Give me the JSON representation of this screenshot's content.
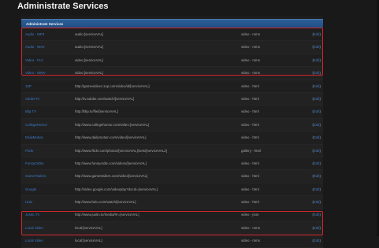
{
  "page": {
    "title": "Administrate Services"
  },
  "panel": {
    "header": "Administrate Services"
  },
  "rows": [
    {
      "name": "Audio - MP3",
      "url": "audio:[serviceVAL]",
      "type": "video - mms",
      "edit_prefix": "(",
      "edit_label": "Edit",
      "edit_suffix": ")"
    },
    {
      "name": "Audio - WAV",
      "url": "audio:[serviceVAL]",
      "type": "video - mms",
      "edit_prefix": "(",
      "edit_label": "Edit",
      "edit_suffix": ")"
    },
    {
      "name": "Video - FLV",
      "url": "video:[serviceVAL]",
      "type": "video - mms",
      "edit_prefix": "(",
      "edit_label": "Edit",
      "edit_suffix": ")"
    },
    {
      "name": "Video - WMV",
      "url": "video:[serviceVAL]",
      "type": "video - mms",
      "edit_prefix": "(",
      "edit_label": "Edit",
      "edit_suffix": ")"
    },
    {
      "name": "10P",
      "url": "http://gamevideos.1up.com/video/id/[serviceVAL]",
      "type": "video - html",
      "edit_prefix": "(",
      "edit_label": "Edit",
      "edit_suffix": ")"
    },
    {
      "name": "AdobeTV",
      "url": "http://tv.adobe.com/watch/[serviceVAL]",
      "type": "video - html",
      "edit_prefix": "(",
      "edit_label": "Edit",
      "edit_suffix": ")"
    },
    {
      "name": "Blip.TV",
      "url": "http://blip.tv/file/[serviceVAL]",
      "type": "video - html",
      "edit_prefix": "(",
      "edit_label": "Edit",
      "edit_suffix": ")"
    },
    {
      "name": "CollegeHumor",
      "url": "http://www.collegehumor.com/video:[serviceVAL]",
      "type": "video - html",
      "edit_prefix": "(",
      "edit_label": "Edit",
      "edit_suffix": ")"
    },
    {
      "name": "DailyMotion",
      "url": "http://www.dailymotion.com/video/[serviceVAL]",
      "type": "video - html",
      "edit_prefix": "(",
      "edit_label": "Edit",
      "edit_suffix": ")"
    },
    {
      "name": "Flickr",
      "url": "http://www.flickr.com/photos/[serviceVAL]/sets/[serviceVAL2]",
      "type": "gallery - html",
      "edit_prefix": "(",
      "edit_label": "Edit",
      "edit_suffix": ")"
    },
    {
      "name": "FunnyOrDie",
      "url": "http://www.funnyordie.com/videos/[serviceVAL]",
      "type": "video - html",
      "edit_prefix": "(",
      "edit_label": "Edit",
      "edit_suffix": ")"
    },
    {
      "name": "GameTrailers",
      "url": "http://www.gametrailers.com/video/[serviceVAL]",
      "type": "video - html",
      "edit_prefix": "(",
      "edit_label": "Edit",
      "edit_suffix": ")"
    },
    {
      "name": "Google",
      "url": "http://video.google.com/videoplay?docid=[serviceVAL]",
      "type": "video - html",
      "edit_prefix": "(",
      "edit_label": "Edit",
      "edit_suffix": ")"
    },
    {
      "name": "Hulu",
      "url": "http://www.hulu.com/watch/[serviceVAL]",
      "type": "video - html",
      "edit_prefix": "(",
      "edit_label": "Edit",
      "edit_suffix": ")"
    },
    {
      "name": "Justin.TV",
      "url": "http://www.justin.tv/media/#r=[serviceVAL]",
      "type": "video - json",
      "edit_prefix": "(",
      "edit_label": "Edit",
      "edit_suffix": ")"
    },
    {
      "name": "Local Video",
      "url": "local:[serviceVAL]",
      "type": "video - mms",
      "edit_prefix": "(",
      "edit_label": "Edit",
      "edit_suffix": ")"
    },
    {
      "name": "Local Video",
      "url": "local:[serviceVAL]",
      "type": "video - mms",
      "edit_prefix": "(",
      "edit_label": "Edit",
      "edit_suffix": ")"
    }
  ],
  "colors": {
    "background": "#191919",
    "header_blue": "#2f5f97",
    "link_blue": "#3d7cc9",
    "highlight_red": "#d3242b"
  }
}
